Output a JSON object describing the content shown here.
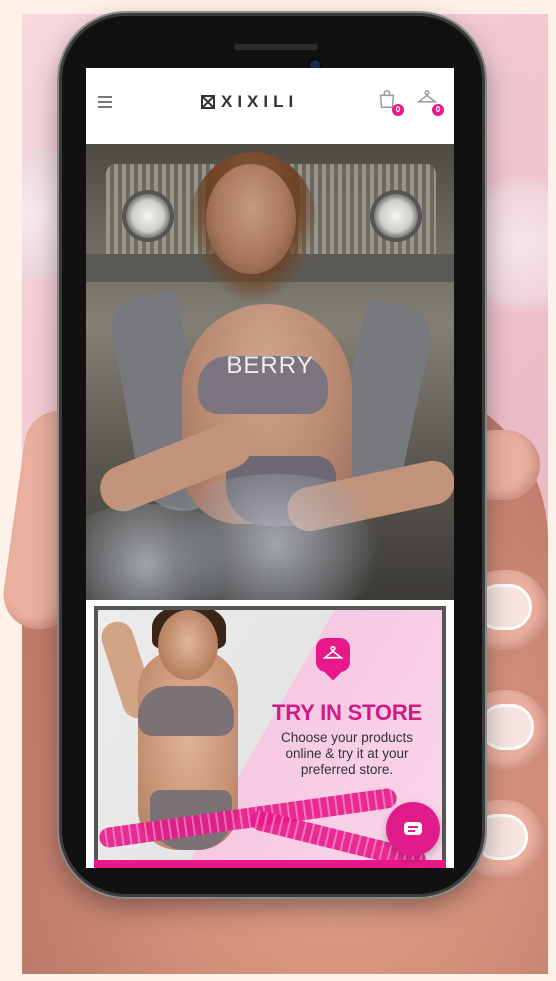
{
  "header": {
    "brand": "XIXILI",
    "menu_icon": "hamburger-menu-icon",
    "cart_icon": "shopping-bag-icon",
    "wishlist_icon": "hanger-icon",
    "cart_count": "0",
    "wishlist_count": "0"
  },
  "hero": {
    "label": "BERRY"
  },
  "promo": {
    "icon": "hanger-location-pin-icon",
    "title": "TRY IN STORE",
    "line1": "Choose your products",
    "line2": "online & try it at your",
    "line3": "preferred store."
  },
  "chat": {
    "icon": "chat-bubble-icon"
  },
  "colors": {
    "brand_pink": "#e8178a",
    "title_pink": "#d01a86"
  }
}
